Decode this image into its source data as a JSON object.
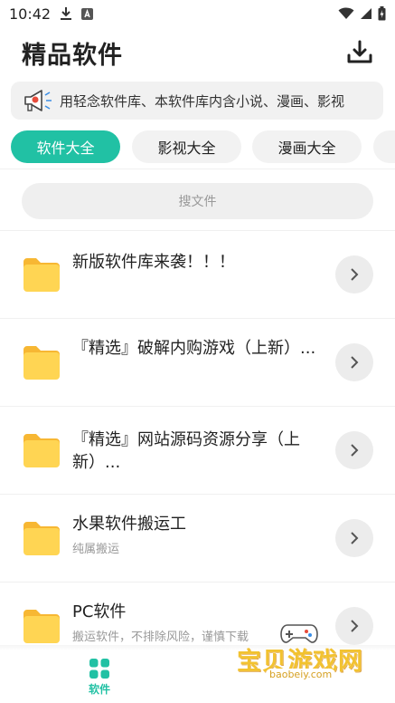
{
  "status_bar": {
    "time": "10:42"
  },
  "header": {
    "title": "精品软件",
    "download_icon": "download-icon"
  },
  "notice": {
    "text": "用轻念软件库、本软件库内含小说、漫画、影视"
  },
  "tabs": [
    {
      "label": "软件大全",
      "active": true
    },
    {
      "label": "影视大全",
      "active": false
    },
    {
      "label": "漫画大全",
      "active": false
    }
  ],
  "search": {
    "placeholder": "搜文件"
  },
  "list": [
    {
      "title": "新版软件库来袭！！！",
      "subtitle": ""
    },
    {
      "title": "『精选』破解内购游戏（上新）...",
      "subtitle": ""
    },
    {
      "title": "『精选』网站源码资源分享（上新）...",
      "subtitle": ""
    },
    {
      "title": "水果软件搬运工",
      "subtitle": "纯属搬运"
    },
    {
      "title": "PC软件",
      "subtitle": "搬运软件，不排除风险，谨慎下载"
    }
  ],
  "bottom_nav": {
    "items": [
      {
        "label": "软件",
        "active": true
      }
    ]
  },
  "watermark": {
    "title": "宝贝游戏网",
    "url": "baobeiy.com"
  },
  "colors": {
    "accent": "#21c1a4",
    "folder": "#ffd553"
  }
}
